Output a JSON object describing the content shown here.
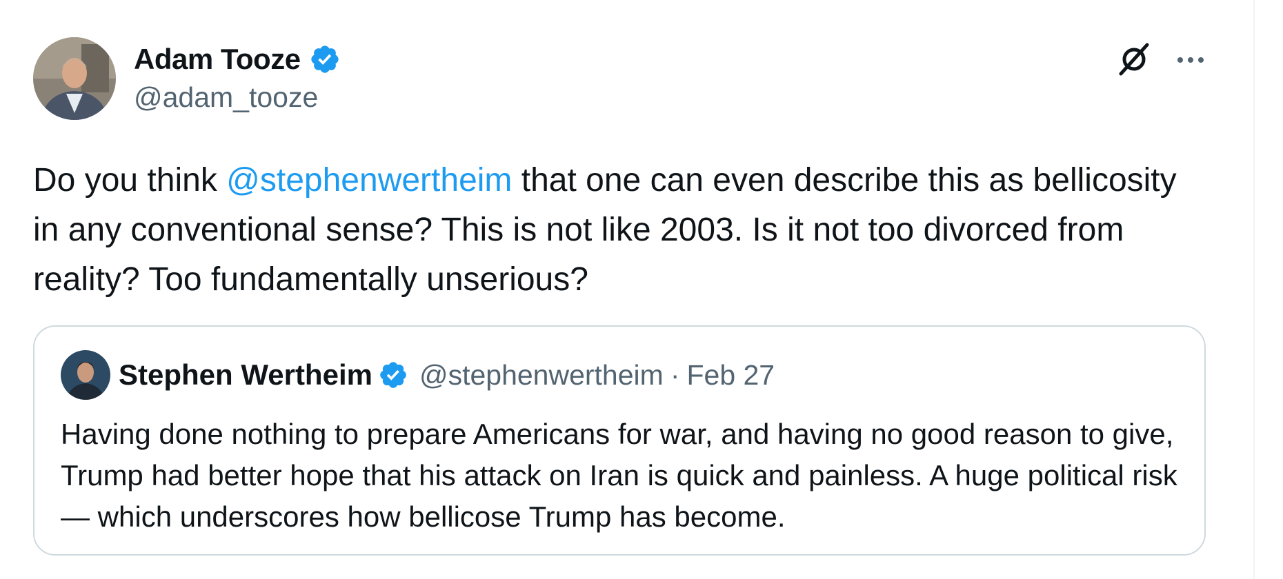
{
  "colors": {
    "accent": "#1d9bf0",
    "secondary_text": "#536471",
    "primary_text": "#0f1419",
    "border": "#cfd9de"
  },
  "tweet": {
    "author": {
      "name": "Adam Tooze",
      "handle": "@adam_tooze",
      "verified": true,
      "avatar_icon": "avatar-photo"
    },
    "actions": {
      "grok_icon": "grok-icon",
      "more_icon": "more-horizontal-icon"
    },
    "text": {
      "before_mention": "Do you think ",
      "mention": "@stephenwertheim",
      "after_mention": " that one can even describe this as bellicosity in any conventional sense? This is not like 2003. Is it not too divorced from reality? Too fundamentally unserious?"
    },
    "quote": {
      "author": {
        "name": "Stephen Wertheim",
        "handle": "@stephenwertheim",
        "verified": true
      },
      "separator": "·",
      "date": "Feb 27",
      "text": "Having done nothing to prepare Americans for war, and having no good reason to give, Trump had better hope that his attack on Iran is quick and painless. A huge political risk — which underscores how bellicose Trump has become."
    }
  }
}
